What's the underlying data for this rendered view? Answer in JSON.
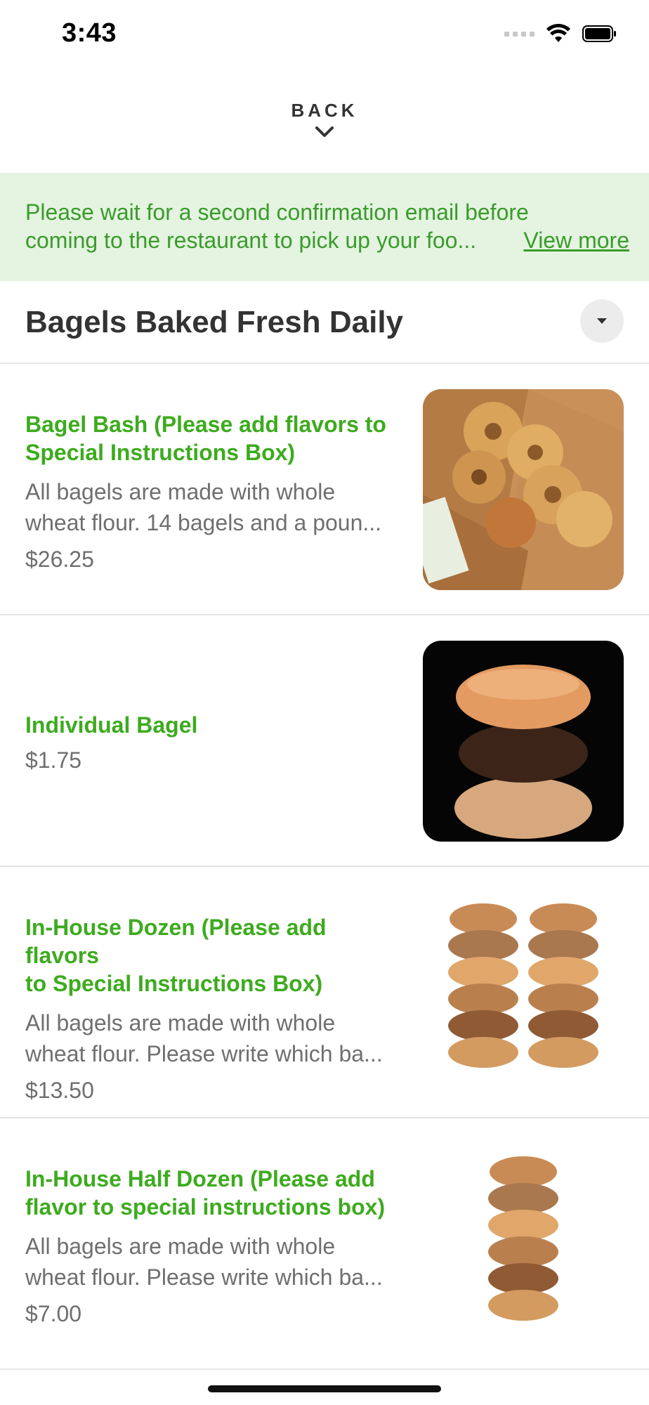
{
  "status": {
    "time": "3:43"
  },
  "nav": {
    "back_label": "BACK"
  },
  "banner": {
    "line1": "Please wait for a second confirmation email before",
    "line2": "coming to the restaurant to pick up your foo...",
    "link": "View more"
  },
  "section": {
    "title": "Bagels Baked Fresh Daily"
  },
  "items": [
    {
      "title_line1": "Bagel Bash  (Please add flavors to",
      "title_line2": "Special Instructions Box)",
      "desc_line1": "All bagels are made with whole",
      "desc_line2": "wheat flour. 14 bagels and a poun...",
      "price": "$26.25"
    },
    {
      "title_line1": "Individual Bagel",
      "price": "$1.75"
    },
    {
      "title_line1": "In-House Dozen (Please add flavors",
      "title_line2": "to Special Instructions Box)",
      "desc_line1": "All bagels are made with whole",
      "desc_line2": "wheat flour. Please write which ba...",
      "price": "$13.50"
    },
    {
      "title_line1": "In-House Half Dozen (Please add",
      "title_line2": "flavor to special instructions box)",
      "desc_line1": "All bagels are made with whole",
      "desc_line2": "wheat flour. Please write which ba...",
      "price": "$7.00"
    }
  ],
  "colors": {
    "accent": "#3dab1e",
    "banner_bg": "#e4f4e1",
    "banner_text": "#3a9b2b"
  }
}
